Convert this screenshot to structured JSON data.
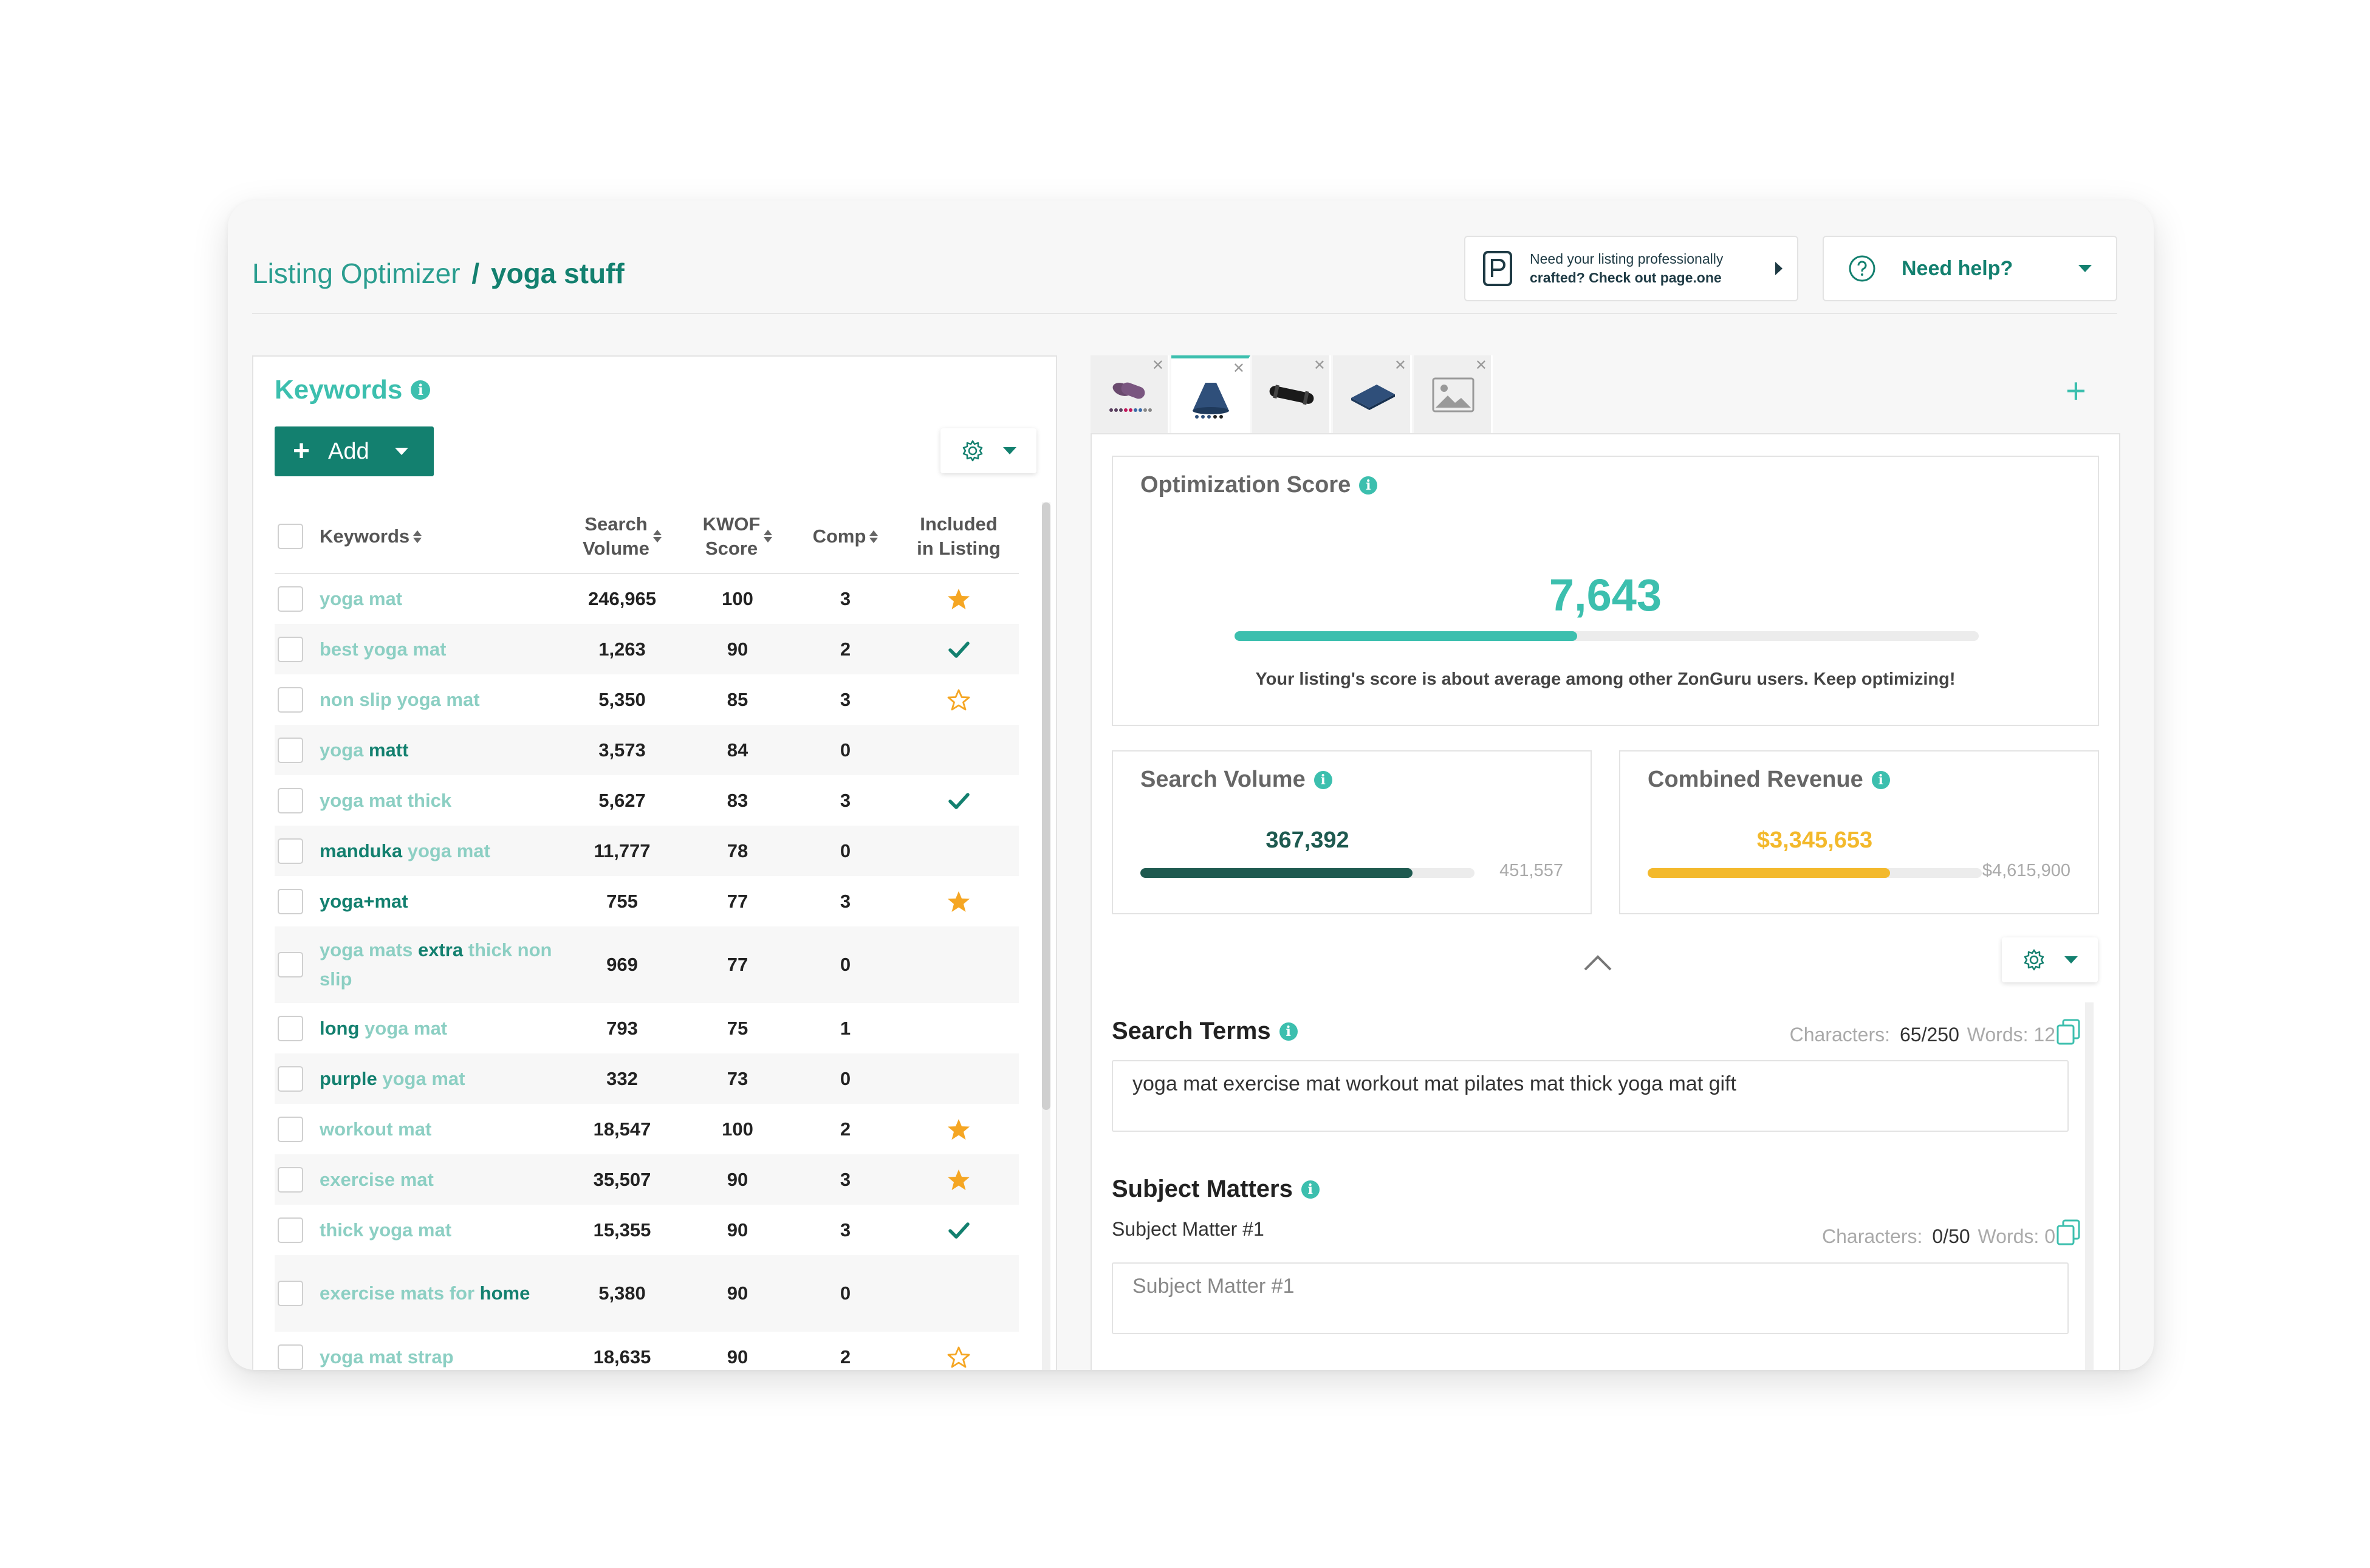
{
  "header": {
    "breadcrumb_root": "Listing Optimizer",
    "breadcrumb_sep": "/",
    "breadcrumb_current": "yoga stuff",
    "promo_line1": "Need your listing professionally",
    "promo_line2_plain": "crafted?",
    "promo_line2_bold": "Check out page.one",
    "help_label": "Need help?"
  },
  "keywords_panel": {
    "title": "Keywords",
    "add_label": "Add",
    "columns": {
      "keywords": "Keywords",
      "search_volume_1": "Search",
      "search_volume_2": "Volume",
      "kwof_1": "KWOF",
      "kwof_2": "Score",
      "comp": "Comp",
      "included_1": "Included",
      "included_2": "in Listing"
    },
    "rows": [
      {
        "parts": [
          {
            "t": "yoga mat",
            "b": false
          }
        ],
        "sv": "246,965",
        "kwof": "100",
        "comp": "3",
        "included": "star-filled"
      },
      {
        "parts": [
          {
            "t": "best yoga mat",
            "b": false
          }
        ],
        "sv": "1,263",
        "kwof": "90",
        "comp": "2",
        "included": "check"
      },
      {
        "parts": [
          {
            "t": "non slip yoga mat",
            "b": false
          }
        ],
        "sv": "5,350",
        "kwof": "85",
        "comp": "3",
        "included": "star-outline"
      },
      {
        "parts": [
          {
            "t": "yoga ",
            "b": false
          },
          {
            "t": "matt",
            "b": true
          }
        ],
        "sv": "3,573",
        "kwof": "84",
        "comp": "0",
        "included": "none"
      },
      {
        "parts": [
          {
            "t": "yoga mat thick",
            "b": false
          }
        ],
        "sv": "5,627",
        "kwof": "83",
        "comp": "3",
        "included": "check"
      },
      {
        "parts": [
          {
            "t": "manduka",
            "b": true
          },
          {
            "t": " yoga mat",
            "b": false
          }
        ],
        "sv": "11,777",
        "kwof": "78",
        "comp": "0",
        "included": "none"
      },
      {
        "parts": [
          {
            "t": "yoga+mat",
            "b": true
          }
        ],
        "sv": "755",
        "kwof": "77",
        "comp": "3",
        "included": "star-filled"
      },
      {
        "parts": [
          {
            "t": "yoga mats ",
            "b": false
          },
          {
            "t": "extra",
            "b": true
          },
          {
            "t": " thick non slip",
            "b": false
          }
        ],
        "sv": "969",
        "kwof": "77",
        "comp": "0",
        "included": "none",
        "tall": true
      },
      {
        "parts": [
          {
            "t": "long",
            "b": true
          },
          {
            "t": " yoga mat",
            "b": false
          }
        ],
        "sv": "793",
        "kwof": "75",
        "comp": "1",
        "included": "none"
      },
      {
        "parts": [
          {
            "t": "purple",
            "b": true
          },
          {
            "t": " yoga mat",
            "b": false
          }
        ],
        "sv": "332",
        "kwof": "73",
        "comp": "0",
        "included": "none"
      },
      {
        "parts": [
          {
            "t": "workout mat",
            "b": false
          }
        ],
        "sv": "18,547",
        "kwof": "100",
        "comp": "2",
        "included": "star-filled"
      },
      {
        "parts": [
          {
            "t": "exercise mat",
            "b": false
          }
        ],
        "sv": "35,507",
        "kwof": "90",
        "comp": "3",
        "included": "star-filled"
      },
      {
        "parts": [
          {
            "t": "thick yoga mat",
            "b": false
          }
        ],
        "sv": "15,355",
        "kwof": "90",
        "comp": "3",
        "included": "check"
      },
      {
        "parts": [
          {
            "t": "exercise mats for ",
            "b": false
          },
          {
            "t": "home",
            "b": true
          }
        ],
        "sv": "5,380",
        "kwof": "90",
        "comp": "0",
        "included": "none",
        "tall": true
      },
      {
        "parts": [
          {
            "t": "yoga mat strap",
            "b": false
          }
        ],
        "sv": "18,635",
        "kwof": "90",
        "comp": "2",
        "included": "star-outline"
      }
    ]
  },
  "tabs": [
    {
      "icon": "purple-yoga-mat-thumb",
      "active": false
    },
    {
      "icon": "blue-yoga-mat-thumb",
      "active": true
    },
    {
      "icon": "black-mat-strap-thumb",
      "active": false
    },
    {
      "icon": "blue-mat-flat-thumb",
      "active": false
    },
    {
      "icon": "image-placeholder-thumb",
      "active": false
    }
  ],
  "optimization": {
    "title": "Optimization Score",
    "value": "7,643",
    "progress_fraction": 0.46,
    "message": "Your listing's score is about average among other ZonGuru users. Keep optimizing!"
  },
  "search_volume": {
    "title": "Search Volume",
    "value": "367,392",
    "max": "451,557",
    "progress_fraction": 0.814
  },
  "combined_revenue": {
    "title": "Combined Revenue",
    "value": "$3,345,653",
    "max": "$4,615,900",
    "progress_fraction": 0.725
  },
  "search_terms": {
    "title": "Search Terms",
    "characters_label": "Characters:",
    "characters_value": "65/250",
    "words_label": "Words: 12",
    "value": "yoga mat exercise mat workout mat pilates mat thick yoga mat gift"
  },
  "subject_matters": {
    "title": "Subject Matters",
    "item_label": "Subject Matter #1",
    "characters_label": "Characters:",
    "characters_value": "0/50",
    "words_label": "Words: 0",
    "placeholder": "Subject Matter #1"
  },
  "colors": {
    "accent": "#3cbfae",
    "dark_teal": "#13806f",
    "revenue": "#f3b92c",
    "volume": "#1e5a50"
  }
}
